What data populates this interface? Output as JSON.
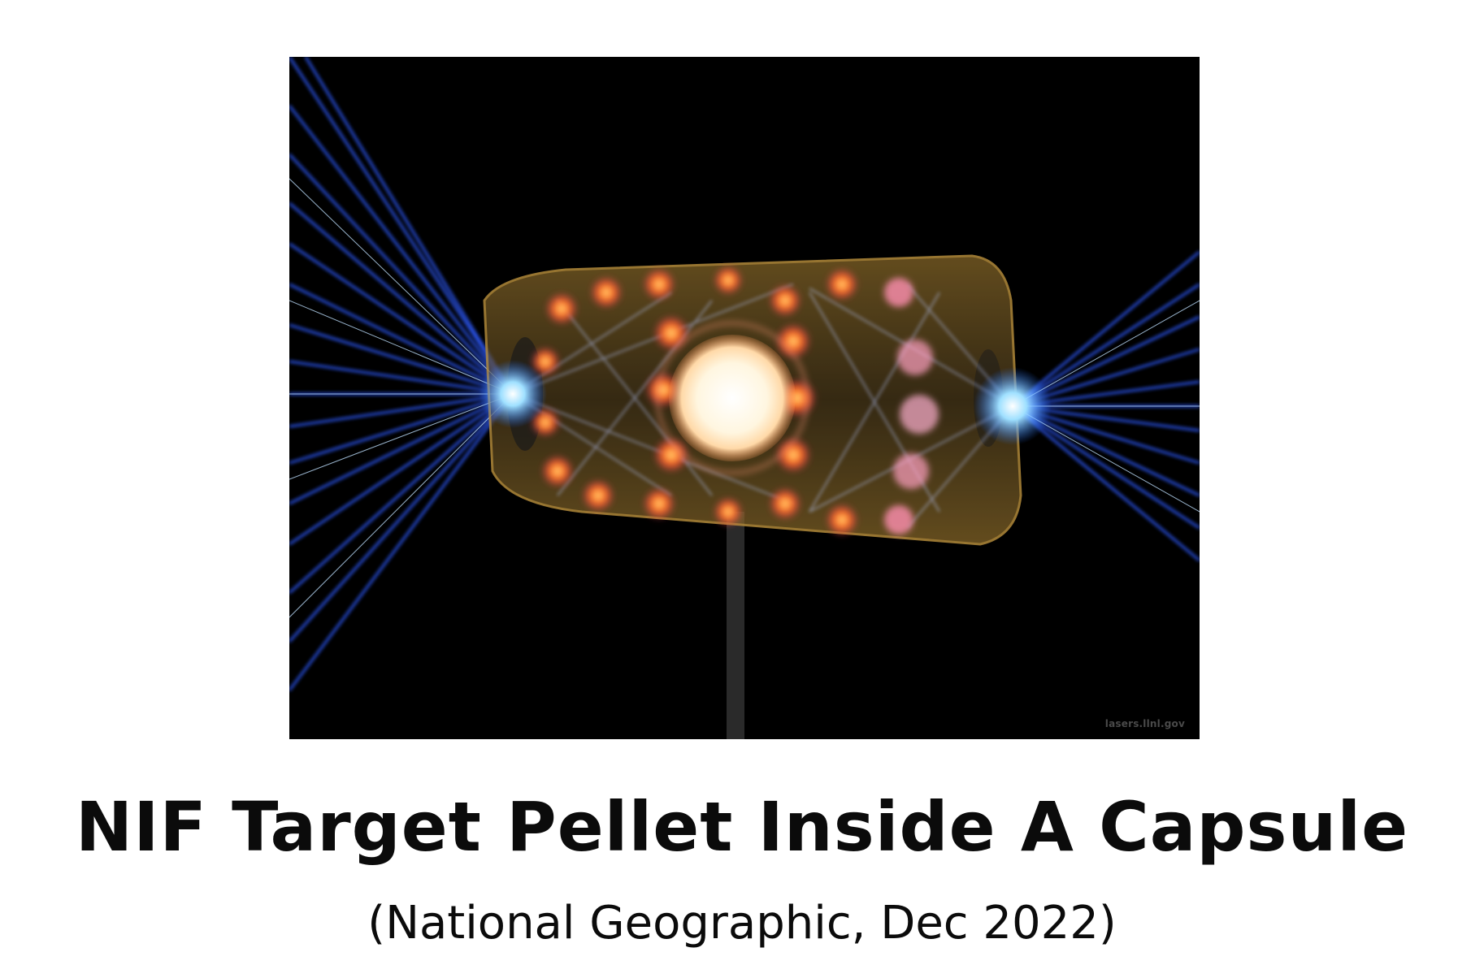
{
  "figure": {
    "watermark": "lasers.llnl.gov",
    "colors": {
      "background": "#000000",
      "laser_beam": "#2f5bff",
      "laser_core": "#cfe6ff",
      "hohlraum_gold": "#c9a24a",
      "hot_spot": "#ff6a1f",
      "capsule_glow": "#fff6e0"
    }
  },
  "caption": {
    "title": "NIF Target Pellet Inside A Capsule",
    "source": "(National Geographic, Dec 2022)"
  }
}
